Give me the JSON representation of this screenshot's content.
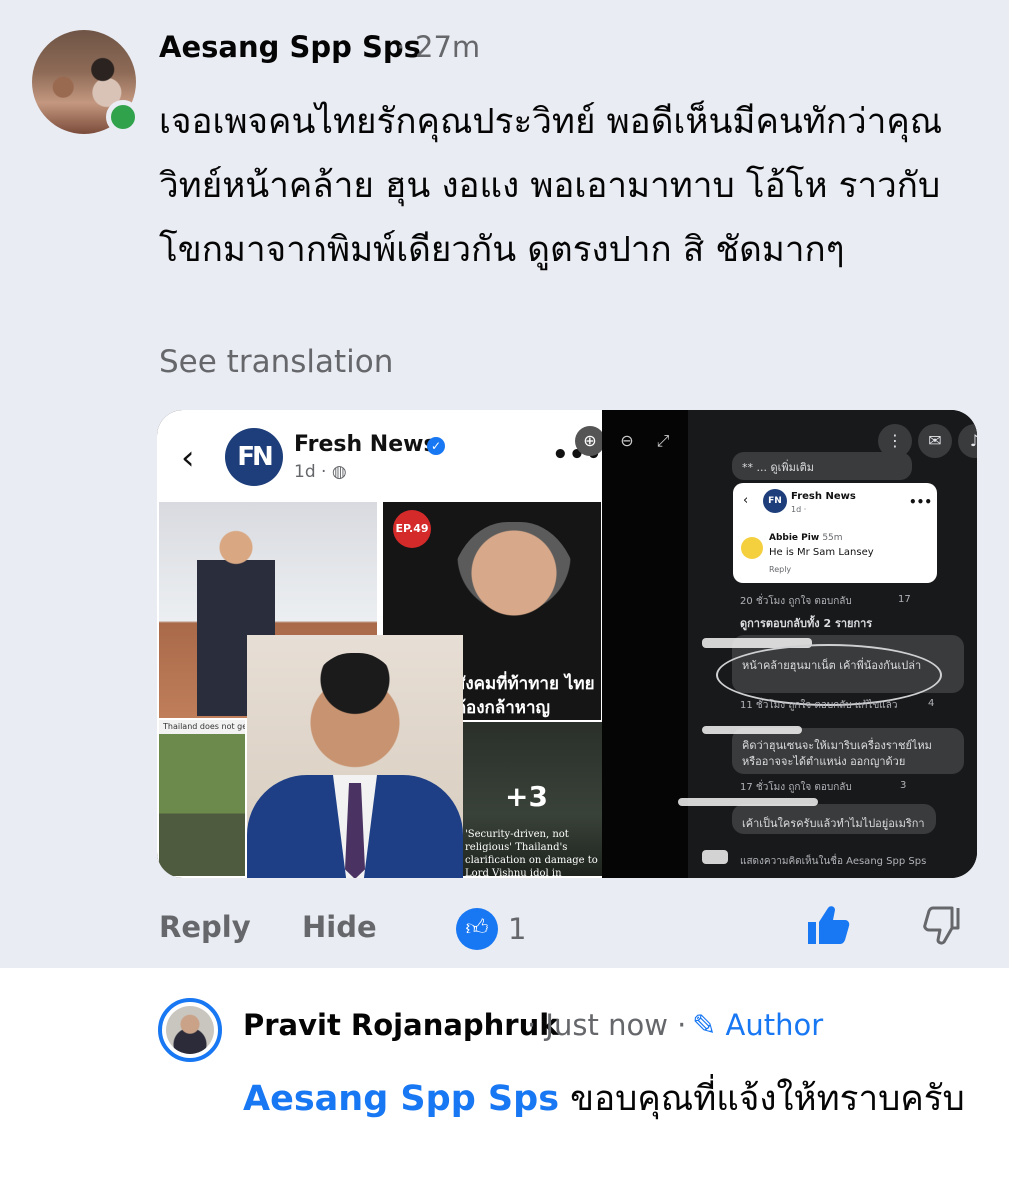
{
  "comment": {
    "author": "Aesang Spp Sps",
    "separator": "·",
    "time": "27m",
    "body": "เจอเพจคนไทยรักคุณประวิทย์ พอดีเห็นมีคนทักว่าคุณวิทย์หน้าคล้าย ฮุน งอแง  พอเอามาทาบ โอ้โห ราวกับโขกมาจากพิมพ์เดียวกัน ดูตรงปาก สิ ชัดมากๆ",
    "see_translation": "See translation",
    "actions": {
      "reply": "Reply",
      "hide": "Hide",
      "like_count": "1"
    },
    "icons": {
      "like": "thumbs-up-icon",
      "dislike": "thumbs-down-icon",
      "online": "online-status-dot"
    },
    "colors": {
      "accent": "#1877f2",
      "online": "#31a24c",
      "background": "#e9ecf3"
    }
  },
  "attachment": {
    "page_name": "Fresh News",
    "logo_text": "FN",
    "post_time": "1d · ",
    "more": "•••",
    "back": "‹",
    "episode_badge": "EP.49",
    "headline_thai": "สังคมที่ท้าทาย ไทยต้องกล้าหาญ",
    "left_caption": "Thailand does not genuinely re... Hindu sites. It has destroyed Hi...",
    "more_photos": "+3",
    "photo_caption": "'Security-driven, not religious' Thailand's clarification on damage to Lord Vishnu idol in Cambodia",
    "right_pane": {
      "see_more": "** ... ดูเพิ่มเติม",
      "card_page": "Fresh News",
      "card_time": "1d · ",
      "card_commenter": "Abbie Piw",
      "card_commenter_time": "55m",
      "card_comment": "He is Mr Sam Lansey",
      "card_reply": "Reply",
      "row1_meta": "20 ชั่วโมง   ถูกใจ   ตอบกลับ",
      "row1_count": "17",
      "see_replies": "ดูการตอบกลับทั้ง 2 รายการ",
      "circled_comment": "หน้าคล้ายฮุนมาเน็ต เค้าพี่น้องกันเปล่า",
      "row2_meta": "11 ชั่วโมง   ถูกใจ   ตอบกลับ   แก้ไขแล้ว",
      "row2_count": "4",
      "comment3_line1": "คิดว่าฮุนเซนจะให้เมาริบเครื่องราชย์ไหม",
      "comment3_line2": "หรืออาจจะได้ตำแหน่ง ออกญาด้วย",
      "row3_meta": "17 ชั่วโมง   ถูกใจ   ตอบกลับ",
      "row3_count": "3",
      "comment4": "เค้าเป็นใครครับแล้วทำไมไปอยู่อเมริกา",
      "input_placeholder": "แสดงความคิดเห็นในชื่อ Aesang Spp Sps"
    }
  },
  "reply": {
    "author": "Pravit Rojanaphruk",
    "meta": "· Just now ·",
    "author_badge": "Author",
    "mention": "Aesang Spp Sps",
    "body": " ขอบคุณที่แจ้งให้ทราบครับ",
    "icons": {
      "author_badge": "pencil-icon"
    }
  }
}
